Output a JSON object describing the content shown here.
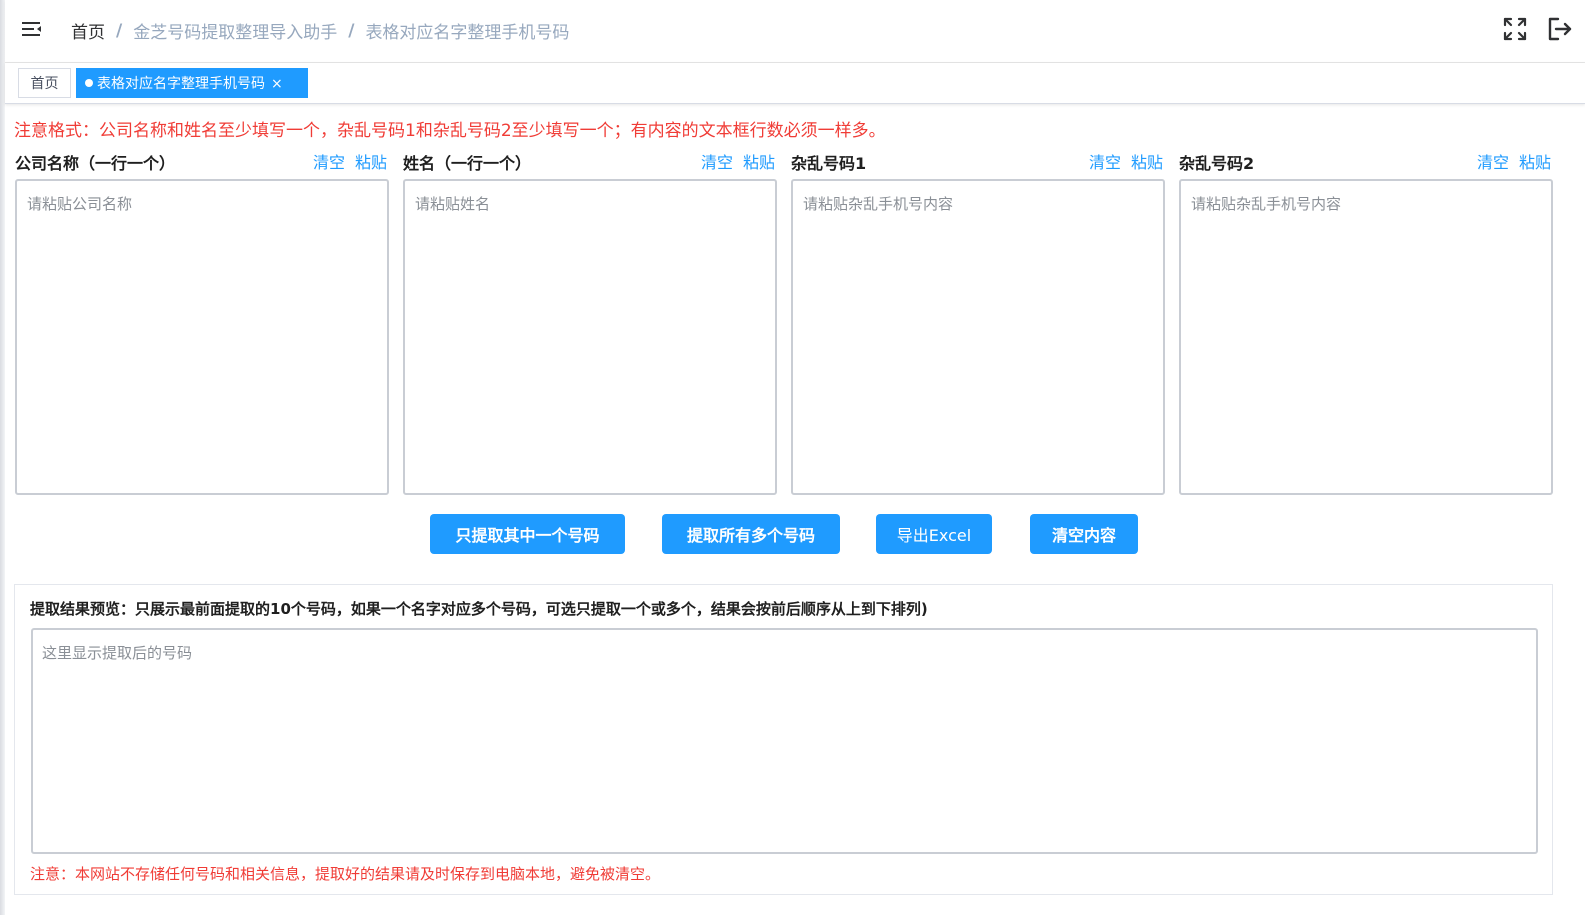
{
  "header": {
    "breadcrumb": {
      "home": "首页",
      "level1": "金芝号码提取整理导入助手",
      "level2": "表格对应名字整理手机号码",
      "separator": "/"
    }
  },
  "tags": {
    "home": "首页",
    "active": "表格对应名字整理手机号码"
  },
  "notice": "注意格式：公司名称和姓名至少填写一个，杂乱号码1和杂乱号码2至少填写一个；有内容的文本框行数必须一样多。",
  "columns": [
    {
      "title": "公司名称（一行一个）",
      "clear": "清空",
      "paste": "粘贴",
      "placeholder": "请粘贴公司名称",
      "value": ""
    },
    {
      "title": "姓名（一行一个）",
      "clear": "清空",
      "paste": "粘贴",
      "placeholder": "请粘贴姓名",
      "value": ""
    },
    {
      "title": "杂乱号码1",
      "clear": "清空",
      "paste": "粘贴",
      "placeholder": "请粘贴杂乱手机号内容",
      "value": ""
    },
    {
      "title": "杂乱号码2",
      "clear": "清空",
      "paste": "粘贴",
      "placeholder": "请粘贴杂乱手机号内容",
      "value": ""
    }
  ],
  "buttons": {
    "extract_one": "只提取其中一个号码",
    "extract_all": "提取所有多个号码",
    "export_excel": "导出Excel",
    "clear_content": "清空内容"
  },
  "result": {
    "title": "提取结果预览：只展示最前面提取的10个号码，如果一个名字对应多个号码，可选只提取一个或多个，结果会按前后顺序从上到下排列)",
    "placeholder": "这里显示提取后的号码",
    "value": "",
    "note": "注意：本网站不存储任何号码和相关信息，提取好的结果请及时保存到电脑本地，避免被清空。"
  },
  "colors": {
    "primary": "#1f9bff",
    "warning": "#f03c36",
    "breadcrumb_link": "#97a8be"
  }
}
